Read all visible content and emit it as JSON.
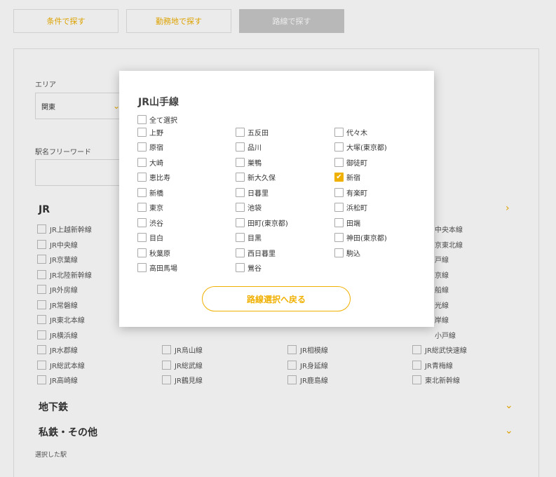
{
  "tabs": [
    {
      "label": "条件で探す"
    },
    {
      "label": "勤務地で探す"
    },
    {
      "label": "路線で探す"
    }
  ],
  "form": {
    "area_label": "エリア",
    "area_value": "関東",
    "keyword_label": "駅名フリーワード",
    "keyword_value": "",
    "selected_label": "選択した駅"
  },
  "groups": {
    "jr": "JR",
    "subway": "地下鉄",
    "private": "私鉄・その他"
  },
  "bg_lines": {
    "col1": [
      "JR上越新幹線",
      "JR中央線",
      "JR京葉線",
      "JR北陸新幹線",
      "JR外房線",
      "JR常磐線",
      "JR東北本線",
      "JR横浜線",
      "JR水郡線",
      "JR総武本線",
      "JR高崎線"
    ],
    "row_lower": [
      "JR烏山線",
      "JR総武線",
      "JR鶴見線",
      "JR相模線",
      "JR身延線",
      "JR鹿島線",
      "JR総武快速線",
      "JR青梅線",
      "東北新幹線"
    ],
    "partial_right": [
      "中央本線",
      "京東北線",
      "戸線",
      "京線",
      "船線",
      "光線",
      "岸線",
      "小戸線"
    ]
  },
  "modal": {
    "title": "JR山手線",
    "select_all": "全て選択",
    "stations": [
      [
        "上野",
        "五反田",
        "代々木"
      ],
      [
        "原宿",
        "品川",
        "大塚(東京都)"
      ],
      [
        "大崎",
        "巣鴨",
        "御徒町"
      ],
      [
        "恵比寿",
        "新大久保",
        "新宿"
      ],
      [
        "新橋",
        "日暮里",
        "有楽町"
      ],
      [
        "東京",
        "池袋",
        "浜松町"
      ],
      [
        "渋谷",
        "田町(東京都)",
        "田端"
      ],
      [
        "目白",
        "目黒",
        "神田(東京都)"
      ],
      [
        "秋葉原",
        "西日暮里",
        "駒込"
      ],
      [
        "高田馬場",
        "鶯谷",
        ""
      ]
    ],
    "checked": [
      "新宿"
    ],
    "back_button": "路線選択へ戻る"
  },
  "colors": {
    "accent": "#f0b000",
    "tab_active_bg": "#c8c8c8"
  }
}
